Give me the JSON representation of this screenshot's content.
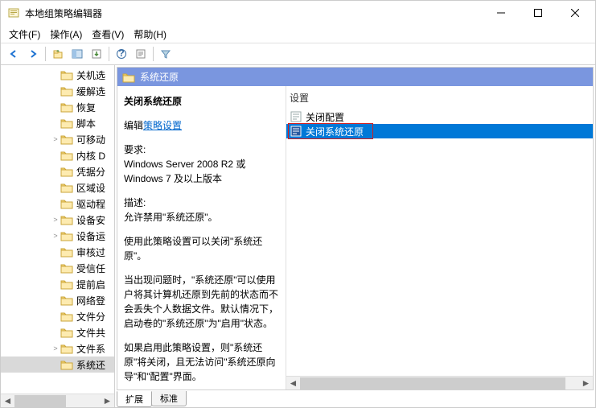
{
  "window": {
    "title": "本地组策略编辑器"
  },
  "menu": {
    "file": "文件(F)",
    "action": "操作(A)",
    "view": "查看(V)",
    "help": "帮助(H)"
  },
  "tree": {
    "items": [
      {
        "label": "关机选",
        "exp": ""
      },
      {
        "label": "缓解选",
        "exp": ""
      },
      {
        "label": "恢复",
        "exp": ""
      },
      {
        "label": "脚本",
        "exp": ""
      },
      {
        "label": "可移动",
        "exp": ">"
      },
      {
        "label": "内核 D",
        "exp": ""
      },
      {
        "label": "凭据分",
        "exp": ""
      },
      {
        "label": "区域设",
        "exp": ""
      },
      {
        "label": "驱动程",
        "exp": ""
      },
      {
        "label": "设备安",
        "exp": ">"
      },
      {
        "label": "设备运",
        "exp": ">"
      },
      {
        "label": "审核过",
        "exp": ""
      },
      {
        "label": "受信任",
        "exp": ""
      },
      {
        "label": "提前启",
        "exp": ""
      },
      {
        "label": "网络登",
        "exp": ""
      },
      {
        "label": "文件分",
        "exp": ""
      },
      {
        "label": "文件共",
        "exp": ""
      },
      {
        "label": "文件系",
        "exp": ">"
      },
      {
        "label": "系统还",
        "exp": "",
        "selected": true
      }
    ]
  },
  "category": {
    "title": "系统还原"
  },
  "description": {
    "title": "关闭系统还原",
    "edit_prefix": "编辑",
    "edit_link": "策略设置",
    "requirements_label": "要求:",
    "requirements_text": "Windows Server 2008 R2 或 Windows 7 及以上版本",
    "desc_label": "描述:",
    "desc_1": "允许禁用\"系统还原\"。",
    "desc_2": "使用此策略设置可以关闭\"系统还原\"。",
    "desc_3": "当出现问题时，\"系统还原\"可以使用户将其计算机还原到先前的状态而不会丢失个人数据文件。默认情况下，启动卷的\"系统还原\"为\"启用\"状态。",
    "desc_4": "如果启用此策略设置，则\"系统还原\"将关闭，且无法访问\"系统还原向导\"和\"配置\"界面。"
  },
  "settings": {
    "header": "设置",
    "items": [
      {
        "label": "关闭配置",
        "selected": false,
        "highlighted": false
      },
      {
        "label": "关闭系统还原",
        "selected": true,
        "highlighted": true
      }
    ]
  },
  "tabs": {
    "extended": "扩展",
    "standard": "标准"
  }
}
